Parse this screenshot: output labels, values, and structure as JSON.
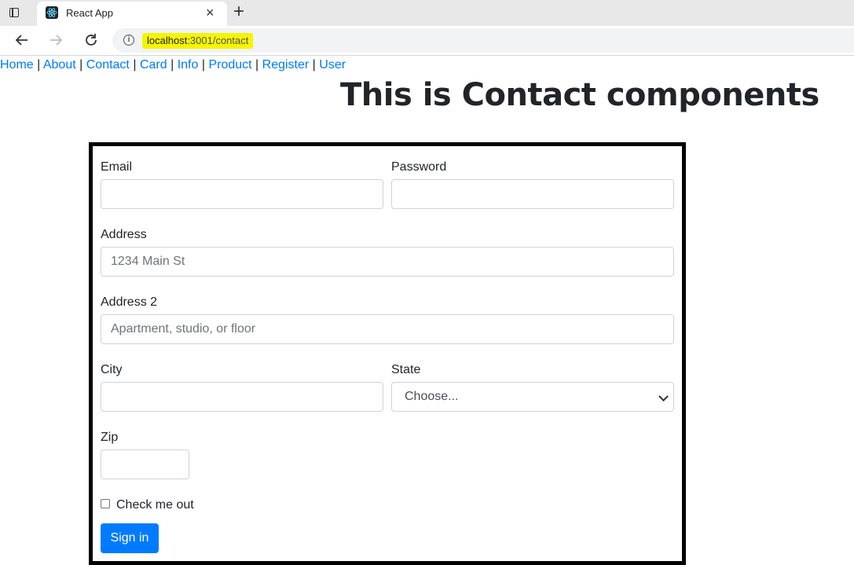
{
  "browser": {
    "tab_title": "React App",
    "tab_close": "×",
    "new_tab": "+",
    "url_host": "localhost",
    "url_path": ":3001/contact"
  },
  "nav": {
    "links": [
      "Home",
      "About",
      "Contact",
      "Card",
      "Info",
      "Product",
      "Register",
      "User"
    ],
    "separator": "|"
  },
  "page": {
    "title": "This is Contact components"
  },
  "form": {
    "email_label": "Email",
    "email_value": "",
    "password_label": "Password",
    "password_value": "",
    "address_label": "Address",
    "address_placeholder": "1234 Main St",
    "address2_label": "Address 2",
    "address2_placeholder": "Apartment, studio, or floor",
    "city_label": "City",
    "city_value": "",
    "state_label": "State",
    "state_selected": "Choose...",
    "zip_label": "Zip",
    "zip_value": "",
    "checkbox_label": "Check me out",
    "checkbox_checked": false,
    "submit_label": "Sign in"
  },
  "colors": {
    "link": "#007bff",
    "primary_button": "#007bff",
    "url_highlight": "#f5f500",
    "form_border": "#000000"
  }
}
